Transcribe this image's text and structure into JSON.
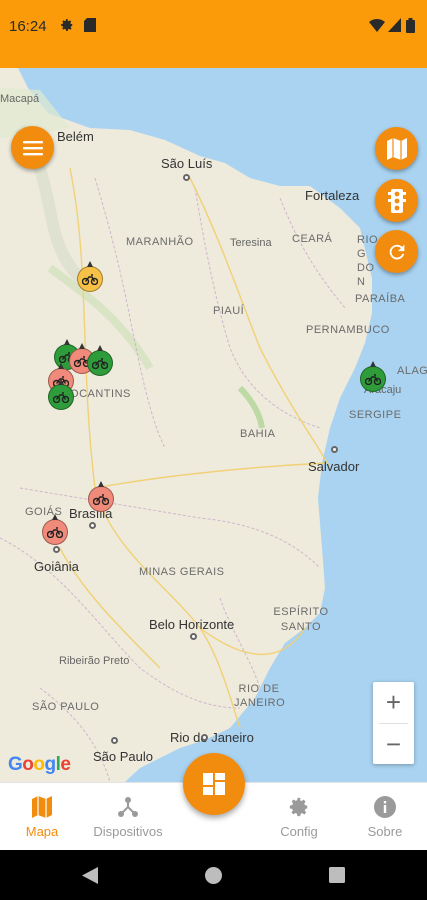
{
  "status_bar": {
    "time": "16:24"
  },
  "map": {
    "cities": {
      "belem": "Belém",
      "sao_luis": "São Luís",
      "fortaleza": "Fortaleza",
      "teresina": "Teresina",
      "salvador": "Salvador",
      "brasilia": "Brasília",
      "goiania": "Goiânia",
      "belo_horizonte": "Belo Horizonte",
      "ribeirao_preto": "Ribeirão Preto",
      "rio_de_janeiro": "Rio de Janeiro",
      "sao_paulo": "São Paulo",
      "aracaju": "Aracaju",
      "macapa": "Macapá"
    },
    "states": {
      "maranhao": "MARANHÃO",
      "ceara": "CEARÁ",
      "rio_grande_do_norte": "RIO G DO N",
      "paraiba": "PARAÍBA",
      "pernambuco": "PERNAMBUCO",
      "alagoas": "ALAG",
      "piaui": "PIAUÍ",
      "tocantins": "TOCANTINS",
      "sergipe": "SERGIPE",
      "bahia": "BAHIA",
      "goias": "GOIÁS",
      "minas_gerais": "MINAS GERAIS",
      "espirito_santo": "ESPÍRITO SANTO",
      "rio_de_janeiro_state": "RIO DE JANEIRO",
      "sao_paulo_state": "SÃO PAULO"
    },
    "attribution": "Google",
    "zoom_in": "+",
    "zoom_out": "−"
  },
  "markers": [
    {
      "color": "yellow",
      "icon": "motorcycle-icon"
    },
    {
      "color": "green",
      "icon": "motorcycle-icon"
    },
    {
      "color": "red",
      "icon": "motorcycle-icon"
    },
    {
      "color": "green",
      "icon": "motorcycle-icon"
    },
    {
      "color": "red",
      "icon": "motorcycle-icon"
    },
    {
      "color": "green",
      "icon": "motorcycle-icon"
    },
    {
      "color": "green",
      "icon": "motorcycle-icon"
    },
    {
      "color": "red",
      "icon": "motorcycle-icon"
    },
    {
      "color": "red",
      "icon": "motorcycle-icon"
    }
  ],
  "fabs": [
    "menu-icon",
    "map-icon",
    "traffic-light-icon",
    "refresh-icon"
  ],
  "bottom_nav": {
    "items": [
      {
        "label": "Mapa",
        "icon": "map-icon",
        "active": true
      },
      {
        "label": "Dispositivos",
        "icon": "devices-icon",
        "active": false
      },
      {
        "label": "Config",
        "icon": "gear-icon",
        "active": false
      },
      {
        "label": "Sobre",
        "icon": "info-icon",
        "active": false
      }
    ],
    "center_icon": "dashboard-icon"
  },
  "colors": {
    "accent": "#f28c0f",
    "status_bar": "#fb9b09",
    "ocean": "#a9d3f1",
    "land": "#eeeadc"
  }
}
